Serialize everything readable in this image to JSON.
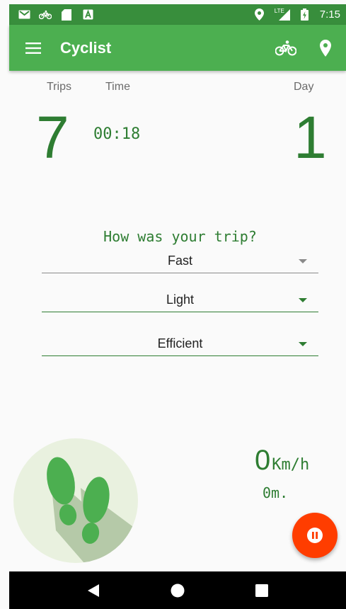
{
  "status_bar": {
    "time": "7:15",
    "network": "LTE",
    "icons": [
      "mail-icon",
      "bike-icon",
      "sd-card-icon",
      "a-icon",
      "location-icon",
      "signal-icon",
      "battery-icon"
    ]
  },
  "app_bar": {
    "title": "Cyclist",
    "actions": [
      "bike-icon",
      "location-pin-icon"
    ]
  },
  "stats": {
    "trips_label": "Trips",
    "time_label": "Time",
    "day_label": "Day",
    "trips_value": "7",
    "time_value": "00:18",
    "day_value": "1"
  },
  "trip_feedback": {
    "question": "How was your trip?",
    "selects": [
      {
        "value": "Fast"
      },
      {
        "value": "Light"
      },
      {
        "value": "Efficient"
      }
    ]
  },
  "speed": {
    "value": "0",
    "unit": "Km/h"
  },
  "distance": {
    "value": "0m."
  },
  "colors": {
    "status_bar": "#388e3c",
    "app_bar": "#4caf50",
    "accent_text": "#2e7d32",
    "fab": "#ff3d00"
  }
}
